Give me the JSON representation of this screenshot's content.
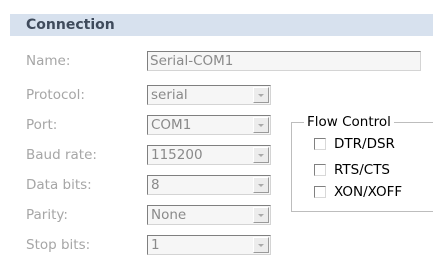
{
  "section": {
    "title": "Connection"
  },
  "fields": {
    "name": {
      "label": "Name:",
      "value": "Serial-COM1"
    },
    "protocol": {
      "label": "Protocol:",
      "value": "serial"
    },
    "port": {
      "label": "Port:",
      "value": "COM1"
    },
    "baud_rate": {
      "label": "Baud rate:",
      "value": "115200"
    },
    "data_bits": {
      "label": "Data bits:",
      "value": "8"
    },
    "parity": {
      "label": "Parity:",
      "value": "None"
    },
    "stop_bits": {
      "label": "Stop bits:",
      "value": "1"
    }
  },
  "flow_control": {
    "title": "Flow Control",
    "options": [
      {
        "label": "DTR/DSR",
        "checked": false
      },
      {
        "label": "RTS/CTS",
        "checked": false
      },
      {
        "label": "XON/XOFF",
        "checked": false
      }
    ]
  },
  "colors": {
    "header_background": "#d7e1ee",
    "header_text": "#3f4b5c",
    "disabled_text": "#a6a6a6"
  },
  "icons": {
    "dropdown": "chevron-down-icon"
  }
}
